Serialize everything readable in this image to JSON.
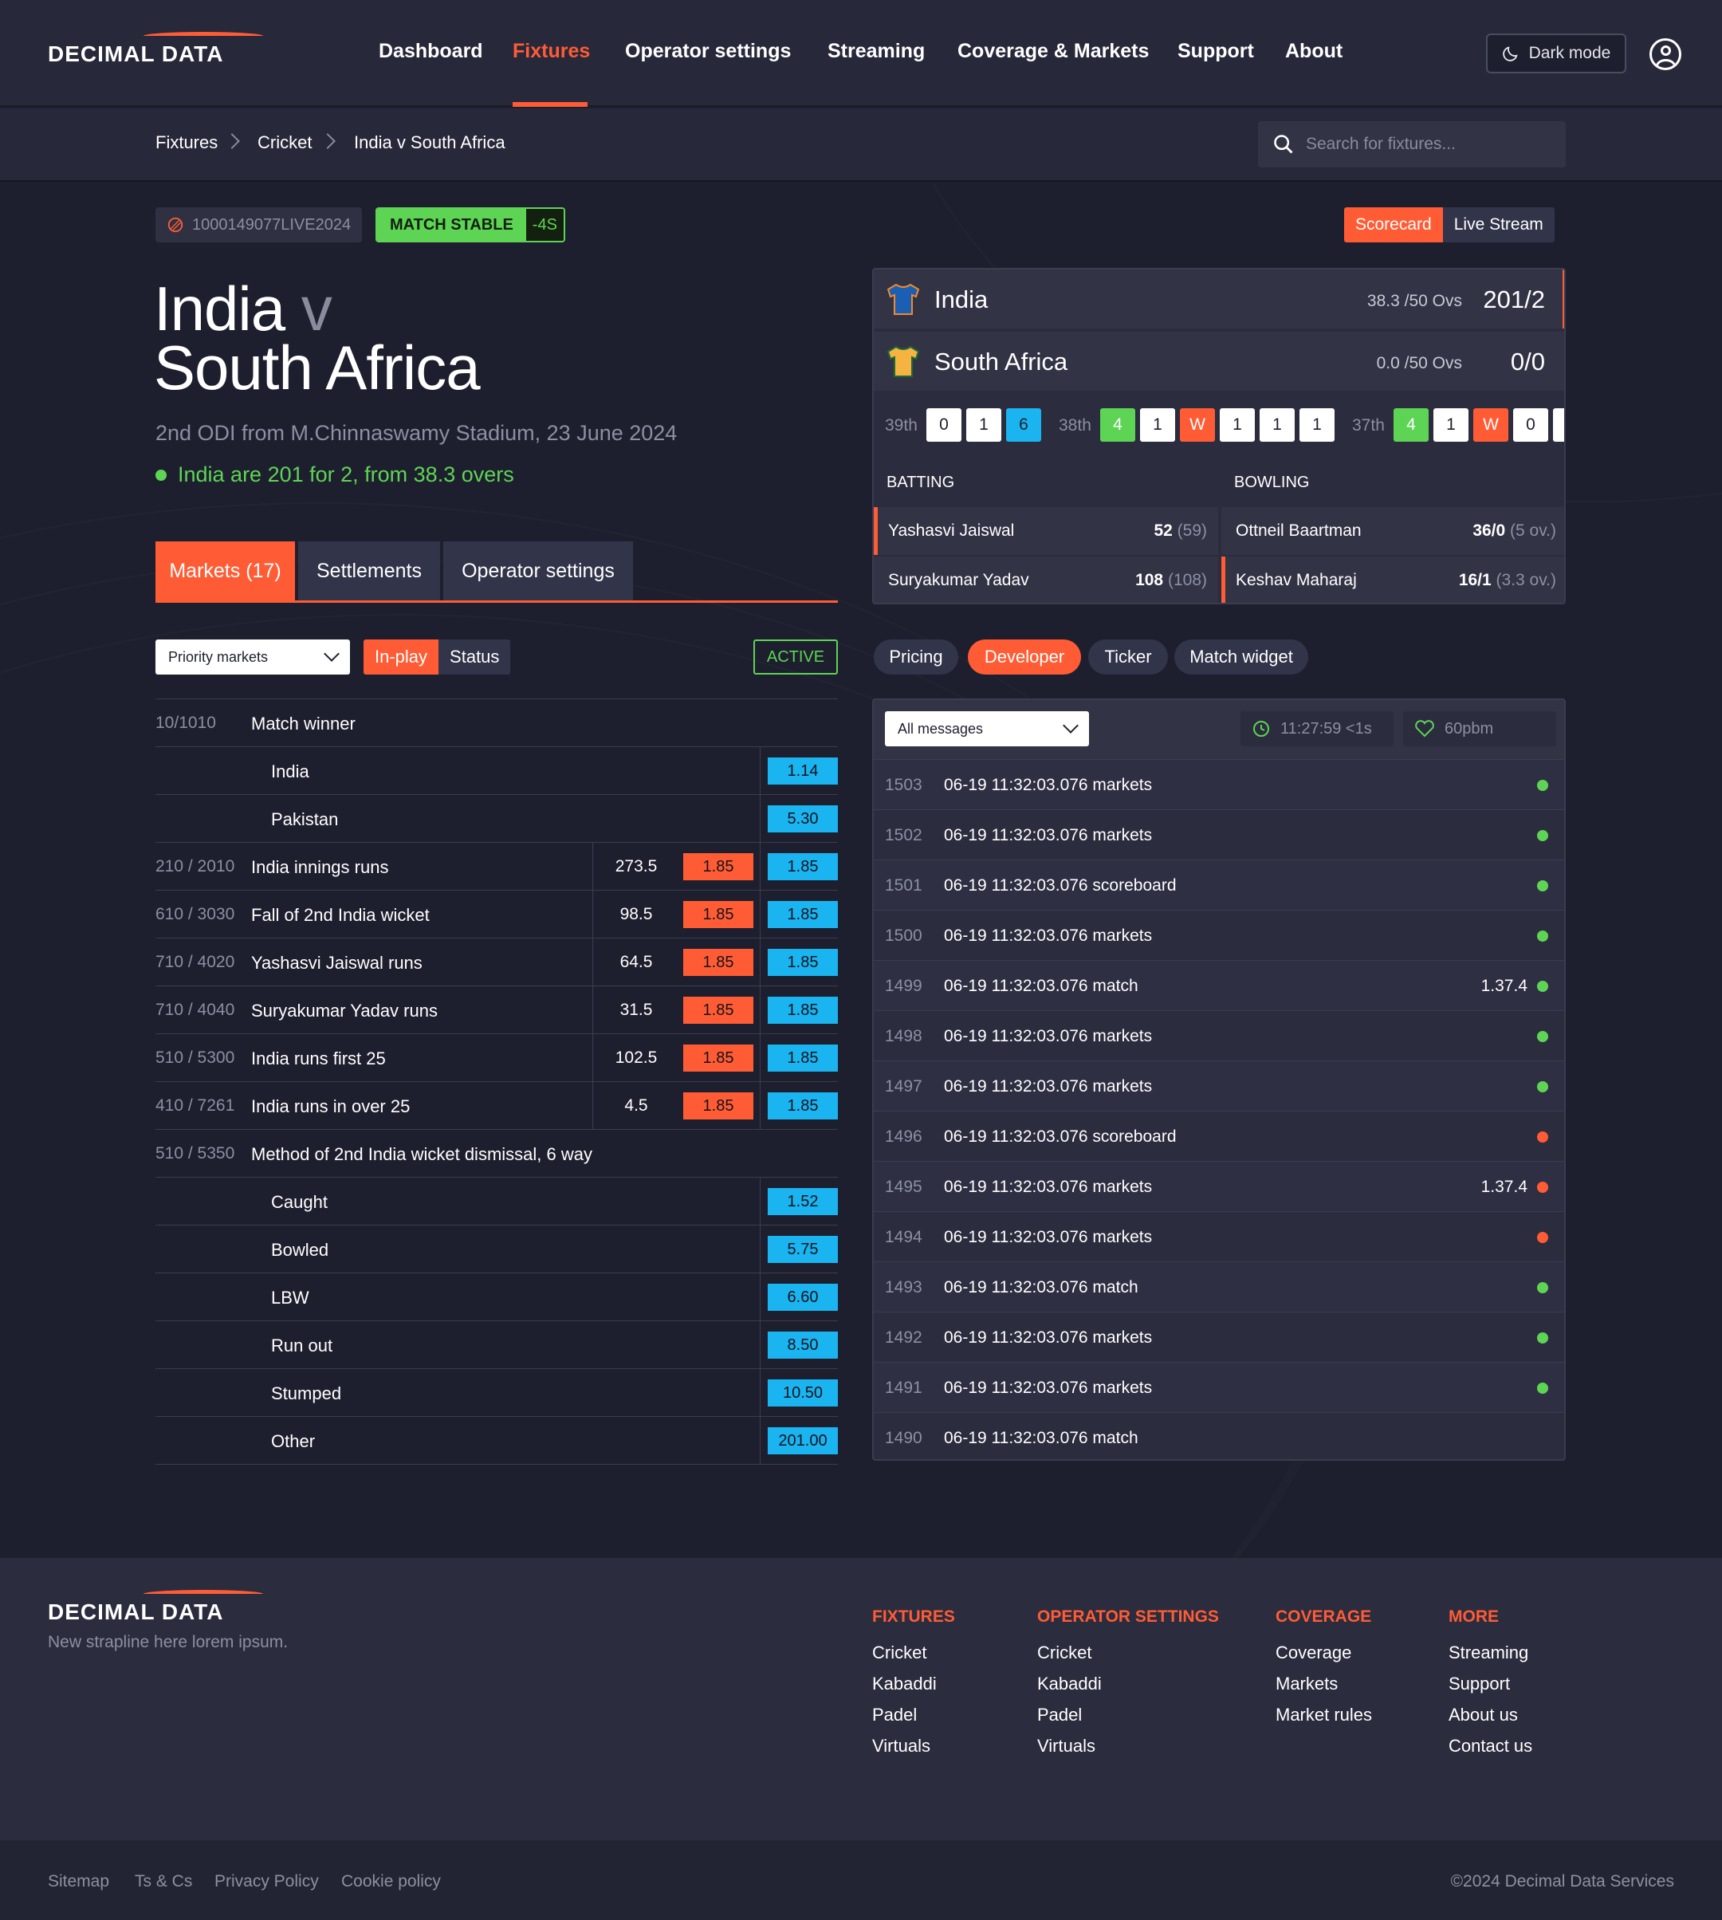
{
  "brand": {
    "name": "DECIMAL DATA"
  },
  "colors": {
    "accent": "#ff5c35",
    "positive": "#5ed455",
    "back": "#1ab4f0",
    "lay": "#ff5c35",
    "background": "#1e1f2e"
  },
  "nav": {
    "items": [
      "Dashboard",
      "Fixtures",
      "Operator settings",
      "Streaming",
      "Coverage & Markets",
      "Support",
      "About"
    ],
    "active": "Fixtures",
    "darkmode_label": "Dark mode"
  },
  "breadcrumb": [
    "Fixtures",
    "Cricket",
    "India v South Africa"
  ],
  "search": {
    "placeholder": "Search for fixtures..."
  },
  "fixture": {
    "id": "1000149077LIVE2024",
    "stable_label": "MATCH STABLE",
    "stable_delay": "-4S",
    "team_home": "India",
    "vs": "v",
    "team_away": "South Africa",
    "subtitle": "2nd ODI from M.Chinnaswamy Stadium, 23 June 2024",
    "status": "India are 201 for 2, from 38.3 overs"
  },
  "tabs": [
    "Markets (17)",
    "Settlements",
    "Operator settings"
  ],
  "filters": {
    "market_select": "Priority markets",
    "toggle": [
      "In-play",
      "Status"
    ],
    "state": "ACTIVE"
  },
  "markets": [
    {
      "type": "header",
      "id": "10/1010",
      "name": "Match winner"
    },
    {
      "type": "selection",
      "name": "India",
      "back": "1.14"
    },
    {
      "type": "selection",
      "name": "Pakistan",
      "back": "5.30"
    },
    {
      "type": "line",
      "id": "210 / 2010",
      "name": "India innings runs",
      "line": "273.5",
      "lay": "1.85",
      "back": "1.85"
    },
    {
      "type": "line",
      "id": "610 / 3030",
      "name": "Fall of 2nd India wicket",
      "line": "98.5",
      "lay": "1.85",
      "back": "1.85"
    },
    {
      "type": "line",
      "id": "710 / 4020",
      "name": "Yashasvi Jaiswal runs",
      "line": "64.5",
      "lay": "1.85",
      "back": "1.85"
    },
    {
      "type": "line",
      "id": "710 / 4040",
      "name": "Suryakumar Yadav runs",
      "line": "31.5",
      "lay": "1.85",
      "back": "1.85"
    },
    {
      "type": "line",
      "id": "510 / 5300",
      "name": "India runs first 25",
      "line": "102.5",
      "lay": "1.85",
      "back": "1.85"
    },
    {
      "type": "line",
      "id": "410 / 7261",
      "name": "India runs in over 25",
      "line": "4.5",
      "lay": "1.85",
      "back": "1.85"
    },
    {
      "type": "header",
      "id": "510 / 5350",
      "name": "Method of 2nd India wicket dismissal, 6 way"
    },
    {
      "type": "selection",
      "name": "Caught",
      "back": "1.52"
    },
    {
      "type": "selection",
      "name": "Bowled",
      "back": "5.75"
    },
    {
      "type": "selection",
      "name": "LBW",
      "back": "6.60"
    },
    {
      "type": "selection",
      "name": "Run out",
      "back": "8.50"
    },
    {
      "type": "selection",
      "name": "Stumped",
      "back": "10.50"
    },
    {
      "type": "selection",
      "name": "Other",
      "back": "201.00"
    }
  ],
  "view_toggle": [
    "Scorecard",
    "Live Stream"
  ],
  "scorecard": {
    "teams": [
      {
        "name": "India",
        "overs": "38.3 /50 Ovs",
        "score": "201/2",
        "shirt_color": "#1a5fb4",
        "batting": true
      },
      {
        "name": "South Africa",
        "overs": "0.0 /50 Ovs",
        "score": "0/0",
        "shirt_color": "#f5b342",
        "batting": false
      }
    ],
    "overs": [
      {
        "label": "39th",
        "balls": [
          {
            "v": "0",
            "c": "plain"
          },
          {
            "v": "1",
            "c": "plain"
          },
          {
            "v": "6",
            "c": "six"
          }
        ]
      },
      {
        "label": "38th",
        "balls": [
          {
            "v": "4",
            "c": "four"
          },
          {
            "v": "1",
            "c": "plain"
          },
          {
            "v": "W",
            "c": "wicket"
          },
          {
            "v": "1",
            "c": "plain"
          },
          {
            "v": "1",
            "c": "plain"
          },
          {
            "v": "1",
            "c": "plain"
          }
        ]
      },
      {
        "label": "37th",
        "balls": [
          {
            "v": "4",
            "c": "four"
          },
          {
            "v": "1",
            "c": "plain"
          },
          {
            "v": "W",
            "c": "wicket"
          },
          {
            "v": "0",
            "c": "plain"
          },
          {
            "v": "",
            "c": "plain"
          }
        ]
      }
    ],
    "batting_header": "BATTING",
    "bowling_header": "BOWLING",
    "batters": [
      {
        "name": "Yashasvi Jaiswal",
        "runs": "52",
        "balls": "(59)",
        "on_strike": true
      },
      {
        "name": "Suryakumar Yadav",
        "runs": "108",
        "balls": "(108)",
        "on_strike": false
      }
    ],
    "bowlers": [
      {
        "name": "Ottneil Baartman",
        "figures": "36/0",
        "overs": "(5 ov.)",
        "bowling": false
      },
      {
        "name": "Keshav Maharaj",
        "figures": "16/1",
        "overs": "(3.3 ov.)",
        "bowling": true
      }
    ]
  },
  "dev_tabs": [
    "Pricing",
    "Developer",
    "Ticker",
    "Match widget"
  ],
  "dev_active": "Developer",
  "messages_toolbar": {
    "filter": "All messages",
    "clock": "11:27:59 <1s",
    "rate": "60pbm"
  },
  "messages": [
    {
      "num": "1503",
      "text": "06-19 11:32:03.076 markets",
      "ver": "",
      "status": "ok"
    },
    {
      "num": "1502",
      "text": "06-19 11:32:03.076 markets",
      "ver": "",
      "status": "ok"
    },
    {
      "num": "1501",
      "text": "06-19 11:32:03.076 scoreboard",
      "ver": "",
      "status": "ok"
    },
    {
      "num": "1500",
      "text": "06-19 11:32:03.076 markets",
      "ver": "",
      "status": "ok"
    },
    {
      "num": "1499",
      "text": "06-19 11:32:03.076 match",
      "ver": "1.37.4",
      "status": "ok"
    },
    {
      "num": "1498",
      "text": "06-19 11:32:03.076 markets",
      "ver": "",
      "status": "ok"
    },
    {
      "num": "1497",
      "text": "06-19 11:32:03.076 markets",
      "ver": "",
      "status": "ok"
    },
    {
      "num": "1496",
      "text": "06-19 11:32:03.076 scoreboard",
      "ver": "",
      "status": "error"
    },
    {
      "num": "1495",
      "text": "06-19 11:32:03.076 markets",
      "ver": "1.37.4",
      "status": "error"
    },
    {
      "num": "1494",
      "text": "06-19 11:32:03.076 markets",
      "ver": "",
      "status": "error"
    },
    {
      "num": "1493",
      "text": "06-19 11:32:03.076 match",
      "ver": "",
      "status": "ok"
    },
    {
      "num": "1492",
      "text": "06-19 11:32:03.076 markets",
      "ver": "",
      "status": "ok"
    },
    {
      "num": "1491",
      "text": "06-19 11:32:03.076 markets",
      "ver": "",
      "status": "ok"
    },
    {
      "num": "1490",
      "text": "06-19 11:32:03.076 match",
      "ver": "",
      "status": "none"
    }
  ],
  "footer": {
    "strapline": "New strapline here lorem ipsum.",
    "columns": [
      {
        "heading": "FIXTURES",
        "items": [
          "Cricket",
          "Kabaddi",
          "Padel",
          "Virtuals"
        ]
      },
      {
        "heading": "OPERATOR SETTINGS",
        "items": [
          "Cricket",
          "Kabaddi",
          "Padel",
          "Virtuals"
        ]
      },
      {
        "heading": "COVERAGE",
        "items": [
          "Coverage",
          "Markets",
          "Market rules"
        ]
      },
      {
        "heading": "MORE",
        "items": [
          "Streaming",
          "Support",
          "About us",
          "Contact us"
        ]
      }
    ],
    "legal_links": [
      "Sitemap",
      "Ts & Cs",
      "Privacy Policy",
      "Cookie policy"
    ],
    "copyright": "©2024 Decimal Data Services"
  }
}
